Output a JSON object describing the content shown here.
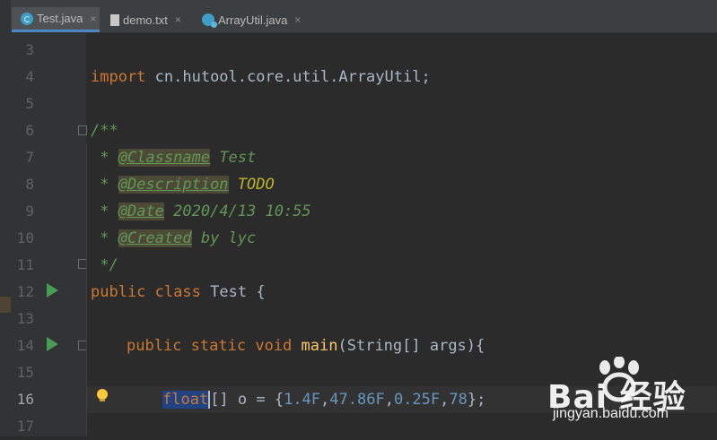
{
  "tabs": [
    {
      "label": "Test.java",
      "icon": "java-class-icon",
      "active": true
    },
    {
      "label": "demo.txt",
      "icon": "text-file-icon",
      "active": false
    },
    {
      "label": "ArrayUtil.java",
      "icon": "library-class-icon",
      "active": false
    }
  ],
  "close_glyph": "×",
  "gutter": {
    "line_numbers": [
      "3",
      "4",
      "5",
      "6",
      "7",
      "8",
      "9",
      "10",
      "11",
      "12",
      "13",
      "14",
      "15",
      "16",
      "17"
    ],
    "current_line": "16",
    "run_icon": "run-gutter-icon",
    "fold_icon": "fold-marker-icon",
    "bulb_icon": "lightbulb-icon"
  },
  "code": {
    "l4": {
      "kw": "import",
      "text": " cn.hutool.core.util.ArrayUtil;"
    },
    "l6": "/**",
    "l7": {
      "star": " * ",
      "tag": "@Classname",
      "rest": " Test"
    },
    "l8": {
      "star": " * ",
      "tag": "@Description",
      "rest": " TODO"
    },
    "l9": {
      "star": " * ",
      "tag": "@Date",
      "rest": " 2020/4/13 10:55"
    },
    "l10": {
      "star": " * ",
      "tag": "@Created",
      "rest": " by lyc"
    },
    "l11": " */",
    "l12": {
      "kw1": "public",
      "kw2": "class",
      "name": "Test",
      "brace": "{"
    },
    "l14": {
      "kw1": "public",
      "kw2": "static",
      "kw3": "void",
      "fn": "main",
      "params": "(String[] args){"
    },
    "l16": {
      "type": "float",
      "arr": "[] o = {",
      "n1": "1.4F",
      "n2": "47.86F",
      "n3": "0.25F",
      "n4": "78",
      "comma": ",",
      "end": "};"
    }
  },
  "watermark": {
    "main": "Bai  经验",
    "sub": "jingyan.baidu.com"
  },
  "colors": {
    "keyword": "#cc7832",
    "doc": "#629755",
    "number": "#6897bb",
    "function": "#ffc66d",
    "todo": "#bbb529",
    "text": "#a9b7c6"
  }
}
